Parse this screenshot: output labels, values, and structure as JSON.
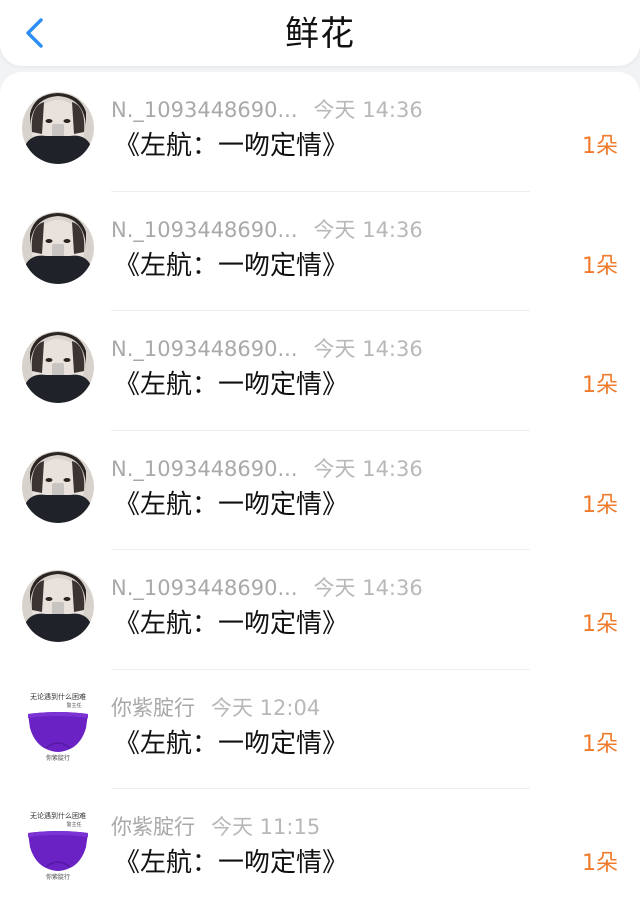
{
  "header": {
    "title": "鲜花",
    "back_icon": "chevron-left-icon",
    "accent_color": "#2b8ef5"
  },
  "gift_list": {
    "items": [
      {
        "sender": "N._1093448690...",
        "time": "今天 14:36",
        "gift": "《左航：一吻定情》",
        "count": "1朵",
        "avatar": "photo-avatar"
      },
      {
        "sender": "N._1093448690...",
        "time": "今天 14:36",
        "gift": "《左航：一吻定情》",
        "count": "1朵",
        "avatar": "photo-avatar"
      },
      {
        "sender": "N._1093448690...",
        "time": "今天 14:36",
        "gift": "《左航：一吻定情》",
        "count": "1朵",
        "avatar": "photo-avatar"
      },
      {
        "sender": "N._1093448690...",
        "time": "今天 14:36",
        "gift": "《左航：一吻定情》",
        "count": "1朵",
        "avatar": "photo-avatar"
      },
      {
        "sender": "N._1093448690...",
        "time": "今天 14:36",
        "gift": "《左航：一吻定情》",
        "count": "1朵",
        "avatar": "photo-avatar"
      },
      {
        "sender": "你紫腚行",
        "time": "今天 12:04",
        "gift": "《左航：一吻定情》",
        "count": "1朵",
        "avatar": "product-avatar",
        "avatar_text_top": "无论遇到什么困难",
        "avatar_text_sub": "警主任",
        "avatar_text_bottom": "你紫腚行"
      },
      {
        "sender": "你紫腚行",
        "time": "今天 11:15",
        "gift": "《左航：一吻定情》",
        "count": "1朵",
        "avatar": "product-avatar",
        "avatar_text_top": "无论遇到什么困难",
        "avatar_text_sub": "警主任",
        "avatar_text_bottom": "你紫腚行"
      }
    ]
  },
  "colors": {
    "count_orange": "#f07b2c",
    "meta_gray": "#a9a9a9",
    "product_purple": "#6a22c4"
  }
}
